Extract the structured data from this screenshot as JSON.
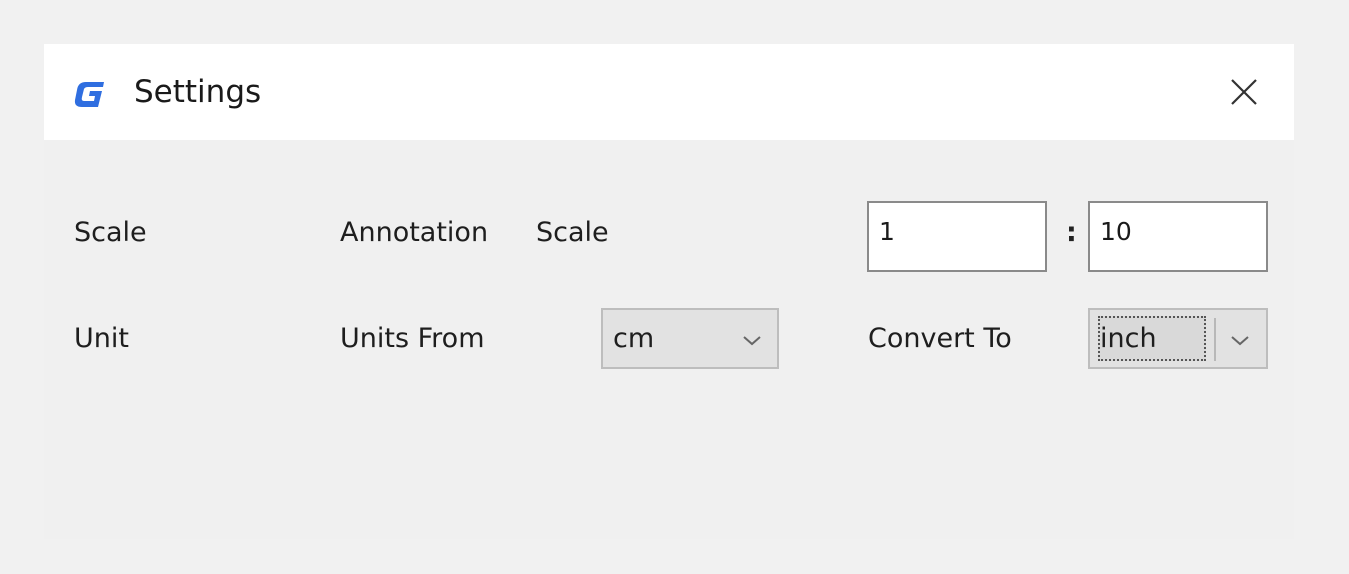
{
  "window": {
    "title": "Settings",
    "app_icon": "gstarcad-g-icon",
    "close_icon": "close-icon"
  },
  "scale_row": {
    "section_label": "Scale",
    "annotation_label": "Annotation",
    "scale_label": "Scale",
    "ratio_left": "1",
    "separator": ":",
    "ratio_right": "10"
  },
  "unit_row": {
    "section_label": "Unit",
    "units_from_label": "Units From",
    "units_from_value": "cm",
    "convert_to_label": "Convert To",
    "convert_to_value": "inch"
  },
  "colors": {
    "accent": "#2f6ee0",
    "background": "#f0f0f0",
    "titlebar": "#ffffff"
  }
}
